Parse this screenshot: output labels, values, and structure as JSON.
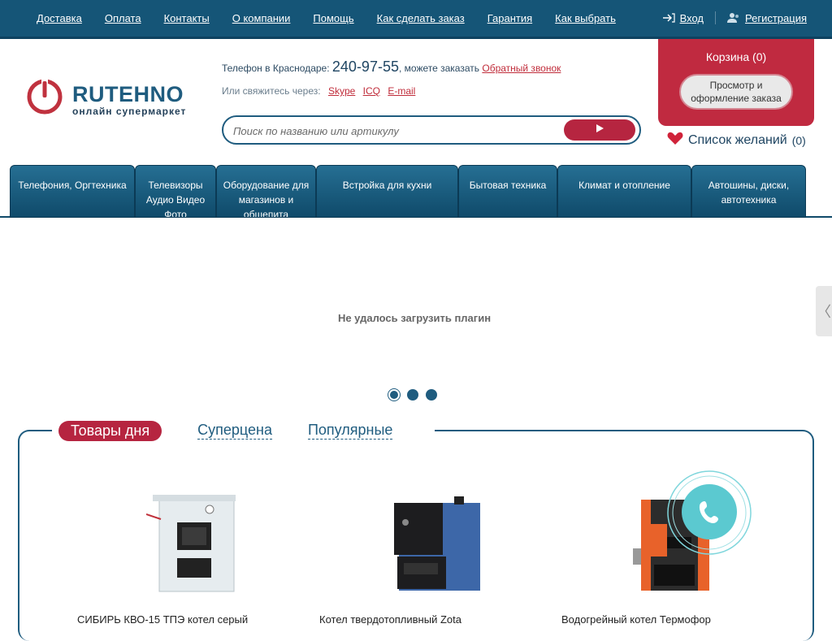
{
  "topnav": {
    "links": [
      "Доставка",
      "Оплата",
      "Контакты",
      "О компании",
      "Помощь",
      "Как сделать заказ",
      "Гарантия",
      "Как выбрать"
    ],
    "login": "Вход",
    "register": "Регистрация"
  },
  "logo": {
    "name": "RUTEHNO",
    "tagline": "онлайн супермаркет"
  },
  "phone": {
    "label": "Телефон в Краснодаре:",
    "number": "240-97-55",
    "order_text": ", можете заказать",
    "callback": "Обратный звонок"
  },
  "contact": {
    "label": "Или свяжитесь через:",
    "channels": [
      "Skype",
      "ICQ",
      "E-mail"
    ]
  },
  "search": {
    "placeholder": "Поиск по названию или артикулу"
  },
  "cart": {
    "title": "Корзина (0)",
    "button": "Просмотр и оформление заказа"
  },
  "wishlist": {
    "label": "Список желаний",
    "count": "(0)"
  },
  "categories": [
    "Телефония, Оргтехника",
    "Телевизоры Аудио Видео Фото",
    "Оборудование для магазинов и общепита",
    "Встройка для кухни",
    "Бытовая техника",
    "Климат и отопление",
    "Автошины, диски, автотехника"
  ],
  "slider": {
    "message": "Не удалось загрузить плагин",
    "arrow": "〈"
  },
  "tabs": [
    "Товары дня",
    "Суперцена",
    "Популярные"
  ],
  "products": [
    {
      "title": "СИБИРЬ КВО-15 ТПЭ котел серый"
    },
    {
      "title": "Котел твердотопливный Zota"
    },
    {
      "title": "Водогрейный котел Термофор"
    }
  ],
  "colors": {
    "brand_blue": "#155577",
    "accent_red": "#b62540"
  }
}
